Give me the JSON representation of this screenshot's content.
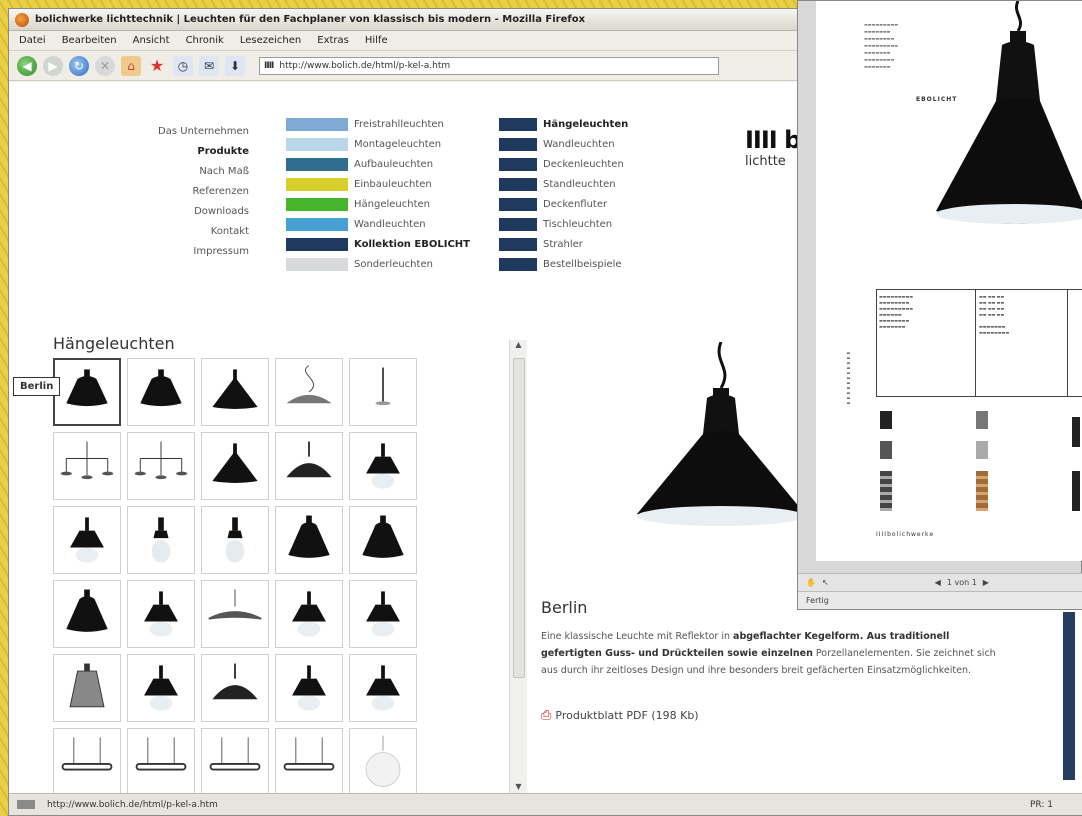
{
  "browser": {
    "title": "bolichwerke lichttechnik | Leuchten für den Fachplaner von klassisch bis modern - Mozilla Firefox",
    "menu": [
      "Datei",
      "Bearbeiten",
      "Ansicht",
      "Chronik",
      "Lesezeichen",
      "Extras",
      "Hilfe"
    ],
    "url": "http://www.bolich.de/html/p-kel-a.htm",
    "status_url": "http://www.bolich.de/html/p-kel-a.htm",
    "status_right": "PR: 1"
  },
  "nav": {
    "main": [
      {
        "label": "Das Unternehmen",
        "active": false
      },
      {
        "label": "Produkte",
        "active": true
      },
      {
        "label": "Nach Maß",
        "active": false
      },
      {
        "label": "Referenzen",
        "active": false
      },
      {
        "label": "Downloads",
        "active": false
      },
      {
        "label": "Kontakt",
        "active": false
      },
      {
        "label": "Impressum",
        "active": false
      }
    ],
    "col1": [
      {
        "label": "Freistrahlleuchten",
        "color": "#7faad6",
        "bold": false
      },
      {
        "label": "Montageleuchten",
        "color": "#b9d7e9",
        "bold": false
      },
      {
        "label": "Aufbauleuchten",
        "color": "#2f6e8e",
        "bold": false
      },
      {
        "label": "Einbauleuchten",
        "color": "#d6cf2c",
        "bold": false
      },
      {
        "label": "Hängeleuchten",
        "color": "#46b52b",
        "bold": false
      },
      {
        "label": "Wandleuchten",
        "color": "#47a0d3",
        "bold": false
      },
      {
        "label": "Kollektion EBOLICHT",
        "color": "#1e3a5f",
        "bold": true
      },
      {
        "label": "Sonderleuchten",
        "color": "#d7d9dc",
        "bold": false
      }
    ],
    "col2": [
      {
        "label": "Hängeleuchten",
        "color": "#1e3a5f",
        "bold": true
      },
      {
        "label": "Wandleuchten",
        "color": "#1e3a5f",
        "bold": false
      },
      {
        "label": "Deckenleuchten",
        "color": "#1e3a5f",
        "bold": false
      },
      {
        "label": "Standleuchten",
        "color": "#1e3a5f",
        "bold": false
      },
      {
        "label": "Deckenfluter",
        "color": "#1e3a5f",
        "bold": false
      },
      {
        "label": "Tischleuchten",
        "color": "#1e3a5f",
        "bold": false
      },
      {
        "label": "Strahler",
        "color": "#1e3a5f",
        "bold": false
      },
      {
        "label": "Bestellbeispiele",
        "color": "#1e3a5f",
        "bold": false
      }
    ]
  },
  "logo": {
    "mark": "IIII b",
    "sub": "lichtte"
  },
  "grid": {
    "title": "Hängeleuchten",
    "tooltip": "Berlin",
    "items": [
      "berlin",
      "bell",
      "cone",
      "dish-cord",
      "stem",
      "multi-arm",
      "multi-arm-2",
      "cone-wide",
      "dome",
      "spike",
      "spike-glass",
      "bulb-glass",
      "bulb-glass-2",
      "bell-tall",
      "bell-tall-2",
      "bell-dark",
      "spike-glass-2",
      "flat-dish",
      "spike-flat",
      "spike-flat-2",
      "cage",
      "spike-glass-3",
      "dome-dark",
      "spike-flat-3",
      "spike-glass-4",
      "bar-1",
      "bar-2",
      "bar-3",
      "bar-4",
      "globe"
    ]
  },
  "product": {
    "name": "Berlin",
    "desc_1": "Eine klassische Leuchte mit Reflektor in ",
    "desc_bold": "abgeflachter Kegelform. Aus traditionell gefertigten Guss- und Drückteilen sowie einzelnen",
    "desc_2": " Porzellanelementen. Sie zeichnet sich aus durch ihr zeitloses Design und ihre besonders breit gefächerten Einsatzmöglichkeiten.",
    "pdf": "Produktblatt PDF (198 Kb)"
  },
  "pdf_viewer": {
    "brand": "EBOLICHT",
    "footer": "IIIIbolichwerke",
    "page_field": "1 von 1",
    "status": "Fertig"
  }
}
